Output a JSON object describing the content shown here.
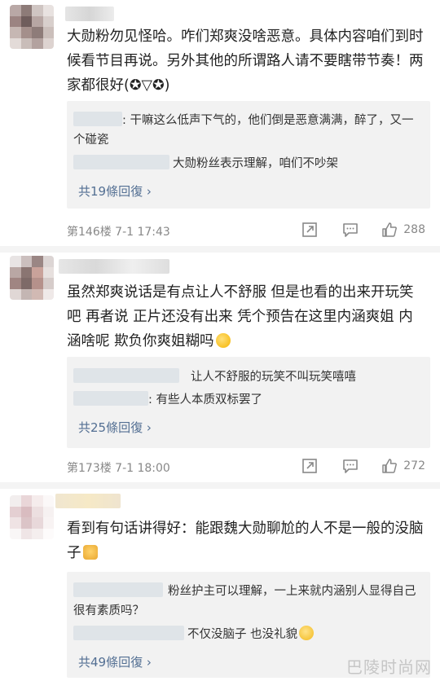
{
  "colors": {
    "link": "#536f93",
    "reply_bg": "#f2f2f2",
    "meta": "#888888"
  },
  "comments": [
    {
      "text": "大勋粉勿见怪哈。咋们郑爽没啥恶意。具体内容咱们到时候看节目再说。另外其他的所谓路人请不要瞎带节奏！两家都很好(✪▽✪)",
      "replies": [
        {
          "text": ": 干嘛这么低声下气的，他们倒是恶意满满，醉了，又一个碰瓷"
        },
        {
          "text": "大勋粉丝表示理解，咱们不吵架"
        }
      ],
      "more": "共19條回復 ›",
      "floor": "第146楼  7-1 17:43",
      "likes": "288",
      "icons": [
        "share-icon",
        "comment-icon",
        "like-icon"
      ]
    },
    {
      "text": "虽然郑爽说话是有点让人不舒服 但是也看的出来开玩笑吧 再者说 正片还没有出来 凭个预告在这里内涵爽姐 内涵啥呢 欺负你爽姐糊吗",
      "replies": [
        {
          "text": "让人不舒服的玩笑不叫玩笑嘻嘻"
        },
        {
          "text": ": 有些人本质双标罢了"
        }
      ],
      "more": "共25條回復 ›",
      "floor": "第173楼  7-1 18:00",
      "likes": "272",
      "icons": [
        "share-icon",
        "comment-icon",
        "like-icon"
      ]
    },
    {
      "text": "看到有句话讲得好：能跟魏大勋聊尬的人不是一般的没脑子",
      "replies": [
        {
          "text": "粉丝护主可以理解，一上来就内涵别人显得自己很有素质吗？"
        },
        {
          "text": "不仅没脑子 也没礼貌"
        }
      ],
      "more": "共49條回復 ›"
    }
  ],
  "watermark": "巴陵时尚网"
}
